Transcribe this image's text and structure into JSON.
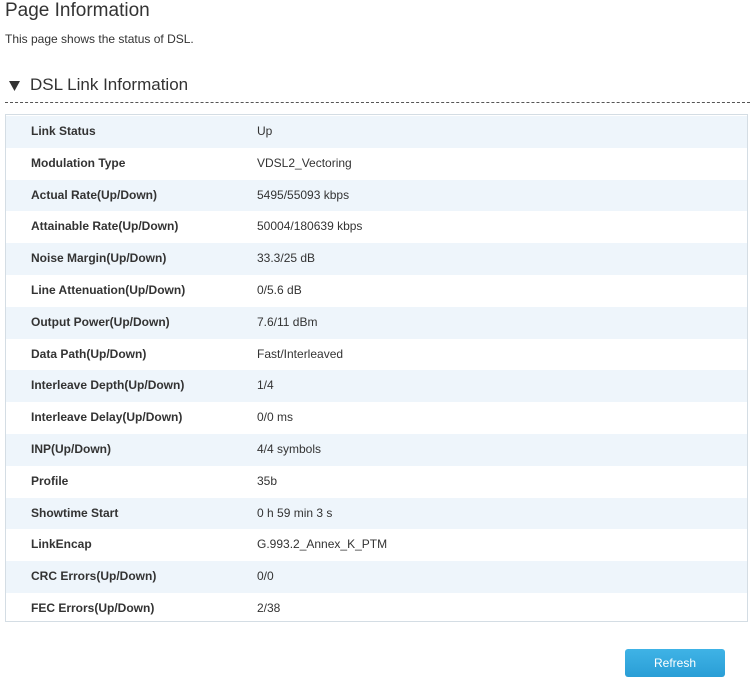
{
  "page": {
    "title": "Page Information",
    "description": "This page shows the status of DSL."
  },
  "section": {
    "title": "DSL Link Information",
    "toggle_icon": "triangle-down-icon"
  },
  "rows": [
    {
      "label": "Link Status",
      "value": "Up"
    },
    {
      "label": "Modulation Type",
      "value": "VDSL2_Vectoring"
    },
    {
      "label": "Actual Rate(Up/Down)",
      "value": "5495/55093 kbps"
    },
    {
      "label": "Attainable Rate(Up/Down)",
      "value": "50004/180639 kbps"
    },
    {
      "label": "Noise Margin(Up/Down)",
      "value": "33.3/25 dB"
    },
    {
      "label": "Line Attenuation(Up/Down)",
      "value": "0/5.6 dB"
    },
    {
      "label": "Output Power(Up/Down)",
      "value": "7.6/11 dBm"
    },
    {
      "label": "Data Path(Up/Down)",
      "value": "Fast/Interleaved"
    },
    {
      "label": "Interleave Depth(Up/Down)",
      "value": "1/4"
    },
    {
      "label": "Interleave Delay(Up/Down)",
      "value": "0/0 ms"
    },
    {
      "label": "INP(Up/Down)",
      "value": "4/4 symbols"
    },
    {
      "label": "Profile",
      "value": "35b"
    },
    {
      "label": "Showtime Start",
      "value": "0 h 59 min 3 s"
    },
    {
      "label": "LinkEncap",
      "value": "G.993.2_Annex_K_PTM"
    },
    {
      "label": "CRC Errors(Up/Down)",
      "value": "0/0"
    },
    {
      "label": "FEC Errors(Up/Down)",
      "value": "2/38"
    }
  ],
  "actions": {
    "refresh_label": "Refresh"
  },
  "colors": {
    "row_stripe": "#eef5fb",
    "panel_border": "#d4dde4",
    "button_blue": "#2a9ed6"
  }
}
